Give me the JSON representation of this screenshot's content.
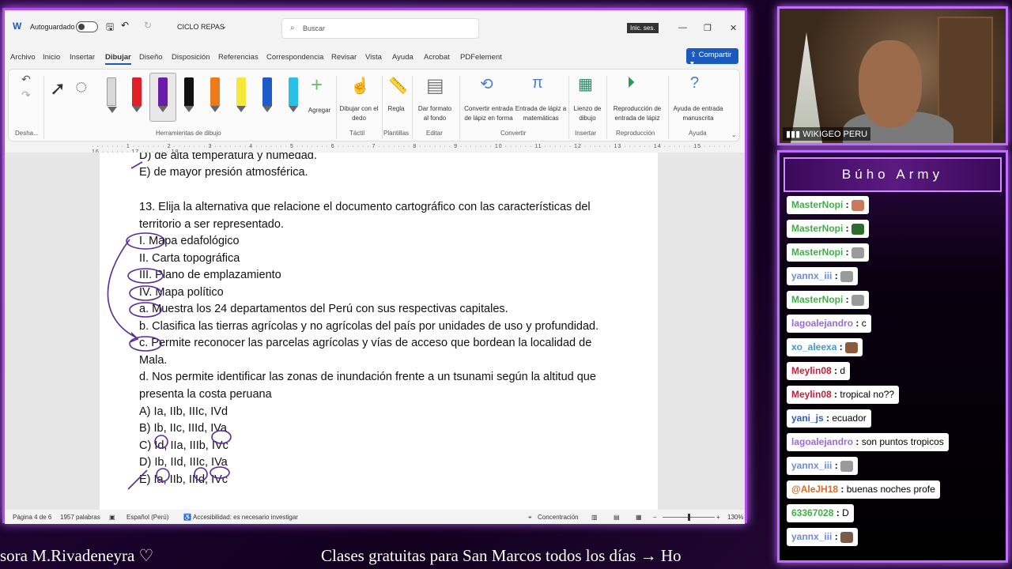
{
  "word": {
    "autosave_label": "Autoguardado",
    "doc_name": "CICLO REPAS",
    "search_placeholder": "Buscar",
    "signin": "Inic. ses.",
    "menu": [
      "Archivo",
      "Inicio",
      "Insertar",
      "Dibujar",
      "Diseño",
      "Disposición",
      "Referencias",
      "Correspondencia",
      "Revisar",
      "Vista",
      "Ayuda",
      "Acrobat",
      "PDFelement"
    ],
    "share_label": "Compartir",
    "ribbon": {
      "undo_group": "Desha...",
      "drawing_tools_group": "Herramientas de dibujo",
      "add_label": "Agregar",
      "draw_finger": "Dibujar con el dedo",
      "ruler": "Regla",
      "format_bg": "Dar formato al fondo",
      "ink_to_shape": "Convertir entrada de lápiz en forma",
      "ink_to_math": "Entrada de lápiz a matemáticas",
      "canvas": "Lienzo de dibujo",
      "replay": "Reproducción de entrada de lápiz",
      "ink_help": "Ayuda de entrada manuscrita",
      "group_tactil": "Táctil",
      "group_plantillas": "Plantillas",
      "group_editar": "Editar",
      "group_convertir": "Convertir",
      "group_insertar": "Insertar",
      "group_reproduccion": "Reproducción",
      "group_ayuda": "Ayuda"
    },
    "document": {
      "lines": [
        "D) de alta temperatura y humedad.",
        "E) de mayor presión atmosférica.",
        "13. Elija la alternativa que relacione el documento cartográfico con las características del",
        "territorio a ser representado.",
        "I. Mapa edafológico",
        "II. Carta topográfica",
        "III. Plano de emplazamiento",
        "IV. Mapa político",
        "a. Muestra los 24 departamentos del Perú con sus respectivas capitales.",
        "b. Clasifica las tierras agrícolas y no agrícolas del país por unidades de uso y profundidad.",
        "c. Permite reconocer las parcelas agrícolas y vías de acceso que bordean la localidad de",
        "Mala.",
        "d. Nos permite identificar las zonas de inundación frente a un tsunami según la altitud que",
        "presenta la costa peruana",
        "A) Ia, IIb, IIIc, IVd",
        "B) Ib, IIc, IIId, IVa",
        "C) Id, IIa, IIIb, IVc",
        "D) Ib, IId, IIIc, IVa",
        "E) Ia, IIb, IIId, IVc"
      ]
    },
    "status": {
      "page": "Página 4 de 6",
      "words": "1957 palabras",
      "lang": "Español (Perú)",
      "accessibility": "Accesibilidad: es necesario investigar",
      "focus": "Concentración",
      "zoom": "130%"
    }
  },
  "camera": {
    "label": "WIKIGEO PERU"
  },
  "chat": {
    "title": "Búho Army",
    "messages": [
      {
        "user": "MasterNopi",
        "text": "",
        "color": "#3cb043",
        "emote": "#c97a5a"
      },
      {
        "user": "MasterNopi",
        "text": "",
        "color": "#3cb043",
        "emote": "#2f6b2f"
      },
      {
        "user": "MasterNopi",
        "text": "",
        "color": "#3cb043",
        "emote": "#9a9a9a"
      },
      {
        "user": "yannx_iii",
        "text": "",
        "color": "#6a8ad8",
        "emote": "#9a9a9a"
      },
      {
        "user": "MasterNopi",
        "text": "",
        "color": "#3cb043",
        "emote": "#9a9a9a"
      },
      {
        "user": "lagoalejandro",
        "text": "c",
        "color": "#9a6ad8",
        "emote": ""
      },
      {
        "user": "xo_aleexa",
        "text": "",
        "color": "#3a9ad8",
        "emote": "#8a5a3a"
      },
      {
        "user": "Meylin08",
        "text": "d",
        "color": "#c0203a",
        "emote": ""
      },
      {
        "user": "Meylin08",
        "text": "tropical no??",
        "color": "#c0203a",
        "emote": ""
      },
      {
        "user": "yani_js",
        "text": "ecuador",
        "color": "#2a5ac8",
        "emote": ""
      },
      {
        "user": "lagoalejandro",
        "text": "son puntos tropicos",
        "color": "#9a6ad8",
        "emote": ""
      },
      {
        "user": "yannx_iii",
        "text": "",
        "color": "#6a8ad8",
        "emote": "#9a9a9a"
      },
      {
        "user": "@AleJH18",
        "text": "buenas noches profe",
        "color": "#d86a2a",
        "emote": ""
      },
      {
        "user": "63367028",
        "text": "D",
        "color": "#3cb043",
        "emote": ""
      },
      {
        "user": "yannx_iii",
        "text": "",
        "color": "#6a8ad8",
        "emote": "#7a5a4a"
      }
    ]
  },
  "ticker": {
    "left": "sora M.Rivadeneyra  ♡",
    "right": "Clases gratuitas para San Marcos todos los días  →  Ho"
  }
}
